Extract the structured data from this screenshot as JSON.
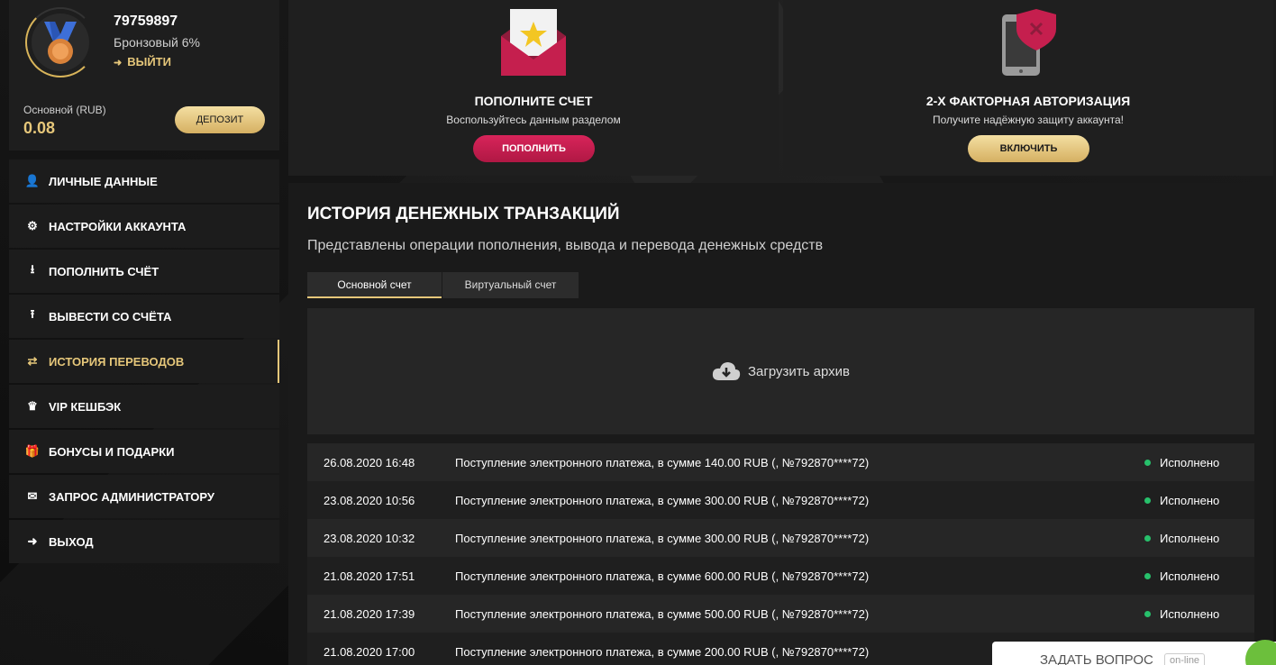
{
  "profile": {
    "user_id": "79759897",
    "level": "Бронзовый 6%",
    "logout_label": "ВЫЙТИ",
    "balance_label": "Основной (RUB)",
    "balance_value": "0.08",
    "deposit_label": "ДЕПОЗИТ"
  },
  "menu": [
    {
      "label": "ЛИЧНЫЕ ДАННЫЕ",
      "icon": "user-plus-icon"
    },
    {
      "label": "НАСТРОЙКИ АККАУНТА",
      "icon": "gears-icon"
    },
    {
      "label": "ПОПОЛНИТЬ СЧЁТ",
      "icon": "download-icon"
    },
    {
      "label": "ВЫВЕСТИ СО СЧЁТА",
      "icon": "upload-icon"
    },
    {
      "label": "ИСТОРИЯ ПЕРЕВОДОВ",
      "icon": "transfer-icon",
      "active": true
    },
    {
      "label": "VIP КЕШБЭК",
      "icon": "crown-icon"
    },
    {
      "label": "БОНУСЫ И ПОДАРКИ",
      "icon": "gift-icon"
    },
    {
      "label": "ЗАПРОС АДМИНИСТРАТОРУ",
      "icon": "envelope-icon"
    },
    {
      "label": "ВЫХОД",
      "icon": "sign-out-icon"
    }
  ],
  "cards": {
    "deposit": {
      "title": "ПОПОЛНИТЕ СЧЕТ",
      "subtitle": "Воспользуйтесь данным разделом",
      "button": "ПОПОЛНИТЬ"
    },
    "twofa": {
      "title": "2-Х ФАКТОРНАЯ АВТОРИЗАЦИЯ",
      "subtitle": "Получите надёжную защиту аккаунта!",
      "button": "ВКЛЮЧИТЬ"
    }
  },
  "history": {
    "title": "ИСТОРИЯ ДЕНЕЖНЫХ ТРАНЗАКЦИЙ",
    "description": "Представлены операции пополнения, вывода и перевода денежных средств",
    "tabs": [
      "Основной счет",
      "Виртуальный счет"
    ],
    "archive_label": "Загрузить архив",
    "rows": [
      {
        "date": "26.08.2020 16:48",
        "desc": "Поступление электронного платежа, в сумме 140.00 RUB (, №792870****72)",
        "status": "Исполнено"
      },
      {
        "date": "23.08.2020 10:56",
        "desc": "Поступление электронного платежа, в сумме 300.00 RUB (, №792870****72)",
        "status": "Исполнено"
      },
      {
        "date": "23.08.2020 10:32",
        "desc": "Поступление электронного платежа, в сумме 300.00 RUB (, №792870****72)",
        "status": "Исполнено"
      },
      {
        "date": "21.08.2020 17:51",
        "desc": "Поступление электронного платежа, в сумме 600.00 RUB (, №792870****72)",
        "status": "Исполнено"
      },
      {
        "date": "21.08.2020 17:39",
        "desc": "Поступление электронного платежа, в сумме 500.00 RUB (, №792870****72)",
        "status": "Исполнено"
      },
      {
        "date": "21.08.2020 17:00",
        "desc": "Поступление электронного платежа, в сумме 200.00 RUB (, №792870****72)",
        "status": ""
      }
    ]
  },
  "chat": {
    "label": "ЗАДАТЬ ВОПРОС",
    "status": "on-line"
  },
  "colors": {
    "accent_gold": "#e6c77a",
    "accent_red": "#c81e4f",
    "status_green": "#27c06b"
  }
}
